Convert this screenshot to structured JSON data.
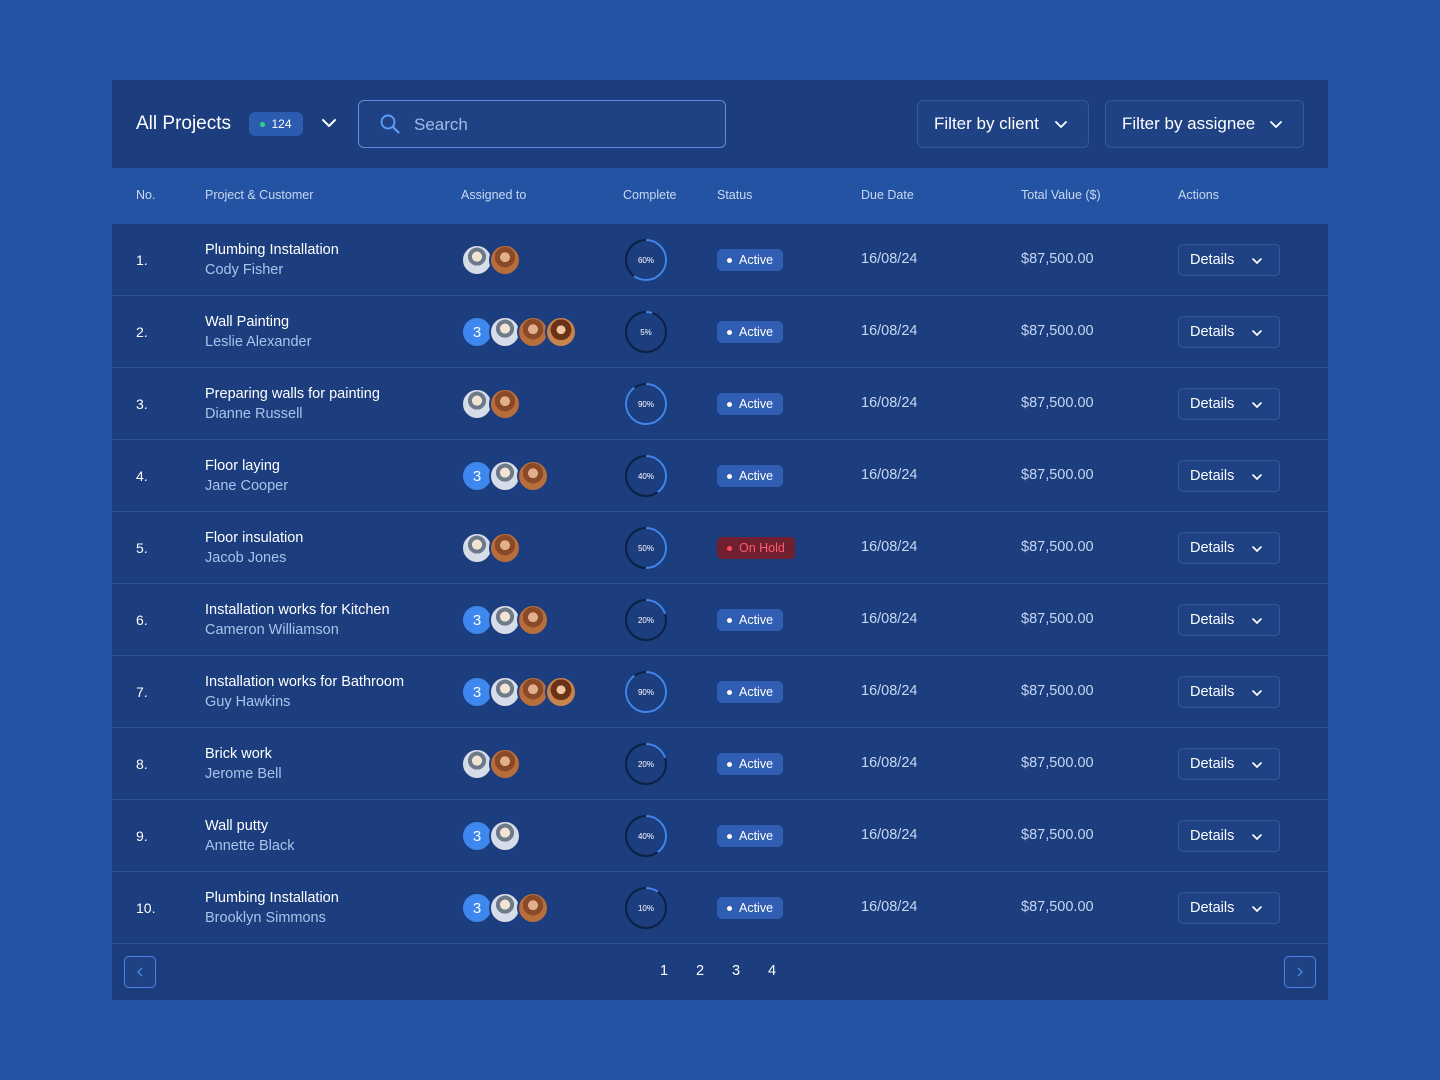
{
  "header": {
    "title": "All Projects",
    "count": "124",
    "search_placeholder": "Search",
    "filter_client": "Filter by client",
    "filter_assignee": "Filter by assignee"
  },
  "colors": {
    "background": "#2453a3",
    "panel": "#1c3e7e",
    "accent": "#3d87ee",
    "active_badge": "#2f5eb3",
    "hold_text": "#ff5c6c",
    "count_dot": "#34d27a"
  },
  "table": {
    "columns": [
      "No.",
      "Project & Customer",
      "Assigned to",
      "Complete",
      "Status",
      "Due Date",
      "Total Value ($)",
      "Actions"
    ],
    "rows": [
      {
        "no": "1.",
        "project": "Plumbing Installation",
        "customer": "Cody Fisher",
        "extra": "",
        "avatars": [
          "p1",
          "p2"
        ],
        "complete": 60,
        "complete_label": "60%",
        "status": "Active",
        "status_type": "active",
        "due": "16/08/24",
        "value": "$87,500.00",
        "action": "Details"
      },
      {
        "no": "2.",
        "project": "Wall Painting",
        "customer": "Leslie Alexander",
        "extra": "3",
        "avatars": [
          "p1",
          "p2",
          "p3"
        ],
        "complete": 5,
        "complete_label": "5%",
        "status": "Active",
        "status_type": "active",
        "due": "16/08/24",
        "value": "$87,500.00",
        "action": "Details"
      },
      {
        "no": "3.",
        "project": "Preparing walls for painting",
        "customer": "Dianne Russell",
        "extra": "",
        "avatars": [
          "p1",
          "p2"
        ],
        "complete": 90,
        "complete_label": "90%",
        "status": "Active",
        "status_type": "active",
        "due": "16/08/24",
        "value": "$87,500.00",
        "action": "Details"
      },
      {
        "no": "4.",
        "project": "Floor laying",
        "customer": "Jane Cooper",
        "extra": "3",
        "avatars": [
          "p1",
          "p2"
        ],
        "complete": 40,
        "complete_label": "40%",
        "status": "Active",
        "status_type": "active",
        "due": "16/08/24",
        "value": "$87,500.00",
        "action": "Details"
      },
      {
        "no": "5.",
        "project": "Floor insulation",
        "customer": "Jacob Jones",
        "extra": "",
        "avatars": [
          "p1",
          "p2"
        ],
        "complete": 50,
        "complete_label": "50%",
        "status": "On Hold",
        "status_type": "hold",
        "due": "16/08/24",
        "value": "$87,500.00",
        "action": "Details"
      },
      {
        "no": "6.",
        "project": "Installation works for Kitchen",
        "customer": "Cameron Williamson",
        "extra": "3",
        "avatars": [
          "p1",
          "p2"
        ],
        "complete": 20,
        "complete_label": "20%",
        "status": "Active",
        "status_type": "active",
        "due": "16/08/24",
        "value": "$87,500.00",
        "action": "Details"
      },
      {
        "no": "7.",
        "project": "Installation works for Bathroom",
        "customer": "Guy Hawkins",
        "extra": "3",
        "avatars": [
          "p1",
          "p2",
          "p3"
        ],
        "complete": 90,
        "complete_label": "90%",
        "status": "Active",
        "status_type": "active",
        "due": "16/08/24",
        "value": "$87,500.00",
        "action": "Details"
      },
      {
        "no": "8.",
        "project": "Brick work",
        "customer": "Jerome Bell",
        "extra": "",
        "avatars": [
          "p1",
          "p2"
        ],
        "complete": 20,
        "complete_label": "20%",
        "status": "Active",
        "status_type": "active",
        "due": "16/08/24",
        "value": "$87,500.00",
        "action": "Details"
      },
      {
        "no": "9.",
        "project": "Wall putty",
        "customer": "Annette Black",
        "extra": "3",
        "avatars": [
          "p1"
        ],
        "complete": 40,
        "complete_label": "40%",
        "status": "Active",
        "status_type": "active",
        "due": "16/08/24",
        "value": "$87,500.00",
        "action": "Details"
      },
      {
        "no": "10.",
        "project": "Plumbing Installation",
        "customer": "Brooklyn Simmons",
        "extra": "3",
        "avatars": [
          "p1",
          "p2"
        ],
        "complete": 10,
        "complete_label": "10%",
        "status": "Active",
        "status_type": "active",
        "due": "16/08/24",
        "value": "$87,500.00",
        "action": "Details"
      }
    ]
  },
  "pagination": {
    "pages": [
      "1",
      "2",
      "3",
      "4"
    ],
    "prev_icon": "chevron-left-icon",
    "next_icon": "chevron-right-icon"
  }
}
